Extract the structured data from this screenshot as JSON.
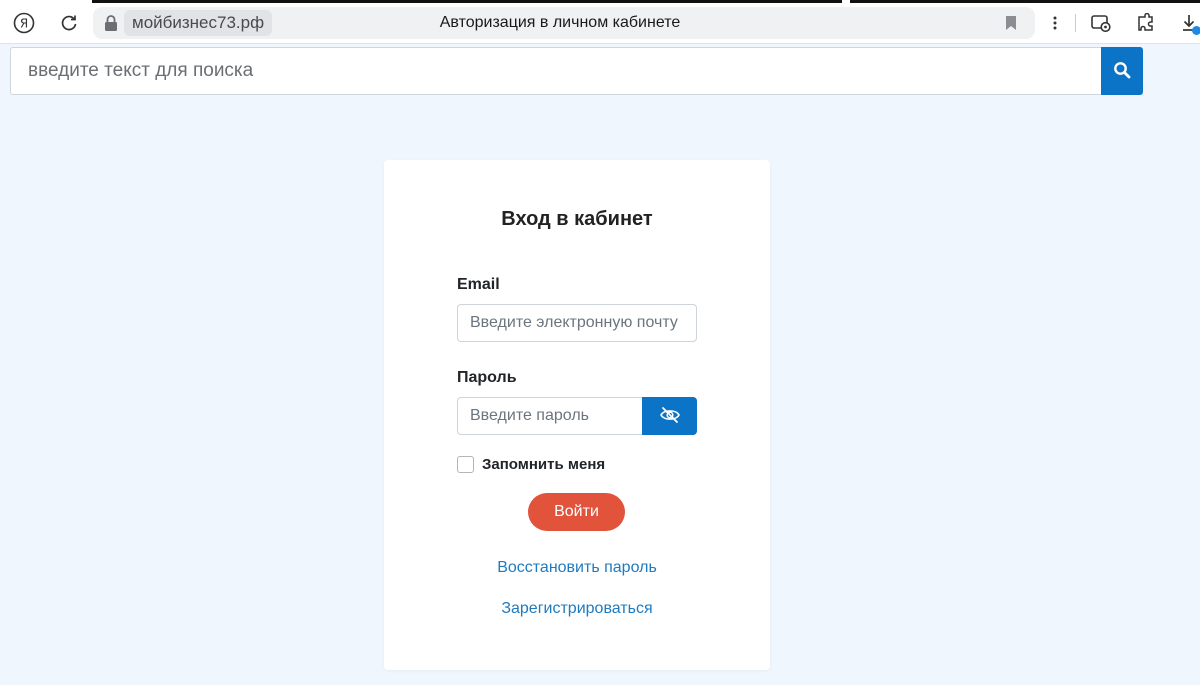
{
  "browser": {
    "domain": "мойбизнес73.рф",
    "tab_title": "Авторизация в личном кабинете",
    "icons": [
      "yandex-logo-icon",
      "reload-icon",
      "lock-icon",
      "bookmark-icon",
      "menu-dots-icon",
      "screenshot-icon",
      "extensions-icon",
      "download-icon"
    ]
  },
  "search": {
    "placeholder": "введите текст для поиска"
  },
  "login": {
    "title": "Вход в кабинет",
    "email_label": "Email",
    "email_placeholder": "Введите электронную почту",
    "password_label": "Пароль",
    "password_placeholder": "Введите пароль",
    "remember_label": "Запомнить меня",
    "submit_label": "Войти",
    "restore_link": "Восстановить пароль",
    "register_link": "Зарегистрироваться"
  },
  "colors": {
    "page_background": "#eff6fd",
    "primary_blue": "#0b74c6",
    "submit_red": "#e2533b",
    "link_blue": "#1f7bc0"
  }
}
